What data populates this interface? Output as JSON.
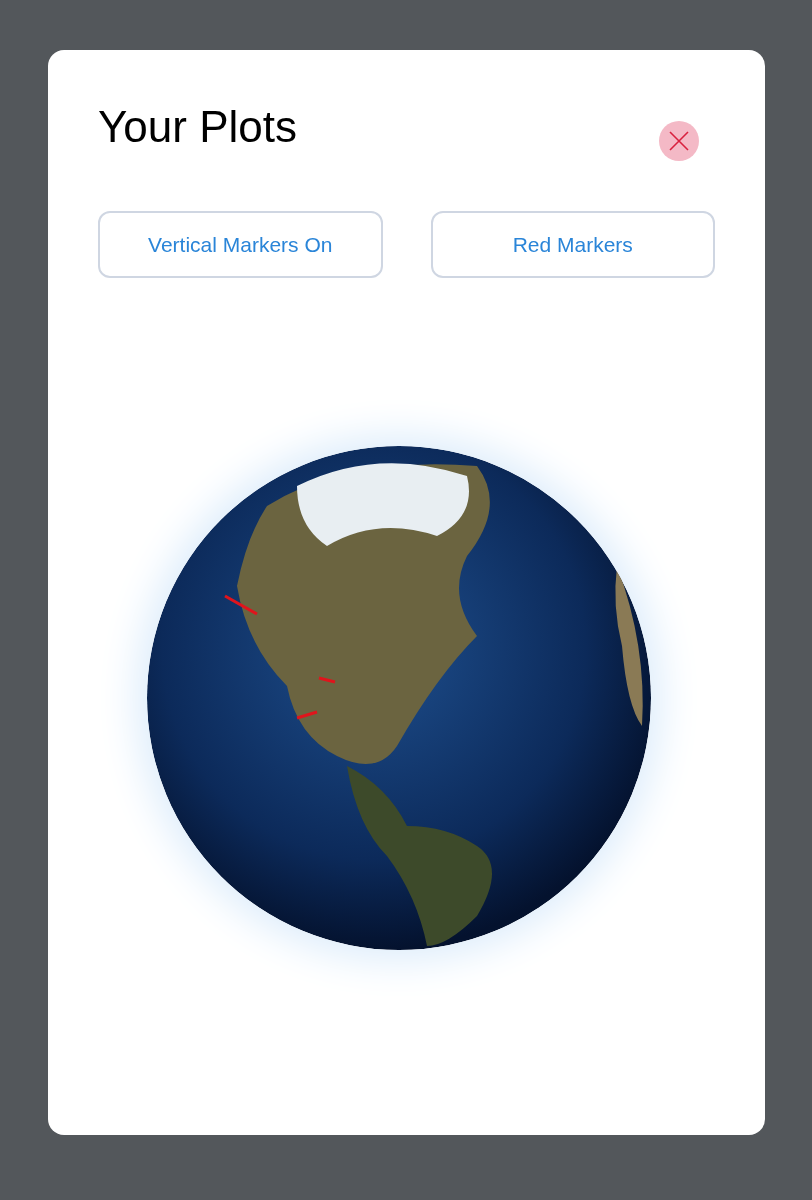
{
  "dialog": {
    "title": "Your Plots"
  },
  "buttons": [
    {
      "label": "Vertical Markers On"
    },
    {
      "label": "Red Markers"
    }
  ]
}
